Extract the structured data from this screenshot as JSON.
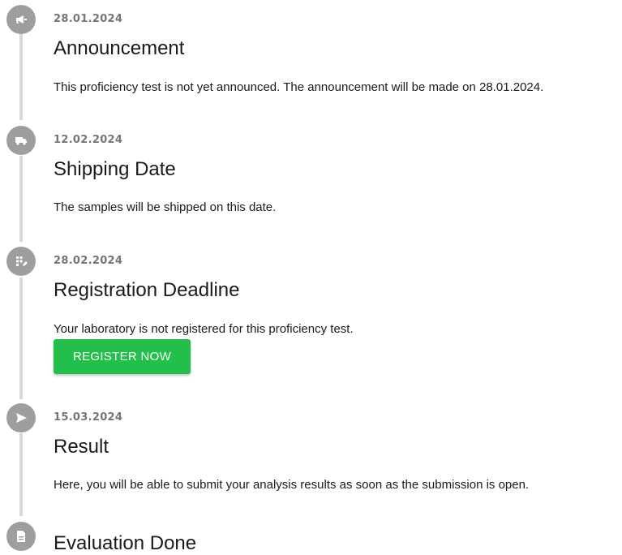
{
  "timeline": {
    "steps": [
      {
        "icon": "megaphone-icon",
        "date": "28.01.2024",
        "title": "Announcement",
        "description": "This proficiency test is not yet announced. The announcement will be made on 28.01.2024."
      },
      {
        "icon": "truck-icon",
        "date": "12.02.2024",
        "title": "Shipping Date",
        "description": "The samples will be shipped on this date."
      },
      {
        "icon": "calendar-grid-icon",
        "date": "28.02.2024",
        "title": "Registration Deadline",
        "description": "Your laboratory is not registered for this proficiency test.",
        "button_label": "REGISTER NOW"
      },
      {
        "icon": "send-icon",
        "date": "15.03.2024",
        "title": "Result",
        "description": "Here, you will be able to submit your analysis results as soon as the submission is open."
      },
      {
        "icon": "document-icon",
        "title": "Evaluation Done"
      }
    ]
  },
  "colors": {
    "icon_circle": "#9e9e9e",
    "rail": "#d9d9d9",
    "register_button": "#22c04a"
  }
}
